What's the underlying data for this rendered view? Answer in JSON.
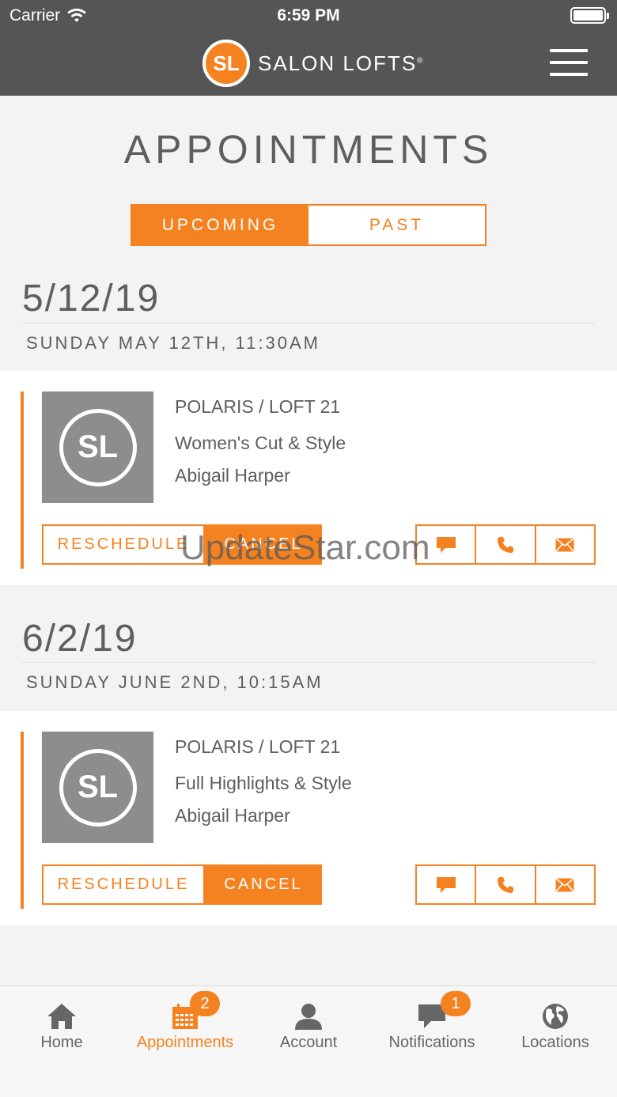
{
  "status_bar": {
    "carrier": "Carrier",
    "time": "6:59 PM"
  },
  "header": {
    "logo_text": "SL",
    "brand_name": "SALON LOFTS",
    "registered": "®"
  },
  "page_title": "APPOINTMENTS",
  "segments": {
    "upcoming": "UPCOMING",
    "past": "PAST"
  },
  "appointments": [
    {
      "date_short": "5/12/19",
      "date_long": "SUNDAY MAY 12TH, 11:30AM",
      "thumb_text": "SL",
      "location": "POLARIS / LOFT 21",
      "service": "Women's Cut & Style",
      "stylist": "Abigail Harper",
      "reschedule_label": "RESCHEDULE",
      "cancel_label": "CANCEL"
    },
    {
      "date_short": "6/2/19",
      "date_long": "SUNDAY JUNE 2ND, 10:15AM",
      "thumb_text": "SL",
      "location": "POLARIS / LOFT 21",
      "service": "Full Highlights & Style",
      "stylist": "Abigail Harper",
      "reschedule_label": "RESCHEDULE",
      "cancel_label": "CANCEL"
    }
  ],
  "watermark": "UpdateStar.com",
  "tabbar": {
    "home": "Home",
    "appointments": "Appointments",
    "appointments_badge": "2",
    "account": "Account",
    "notifications": "Notifications",
    "notifications_badge": "1",
    "locations": "Locations"
  },
  "colors": {
    "accent": "#f58220",
    "header_bg": "#555555",
    "thumb_bg": "#8d8d8d"
  },
  "icons": [
    "wifi-icon",
    "battery-icon",
    "menu-icon",
    "chat-icon",
    "phone-icon",
    "mail-icon",
    "home-icon",
    "calendar-icon",
    "account-icon",
    "notifications-icon",
    "globe-icon"
  ]
}
